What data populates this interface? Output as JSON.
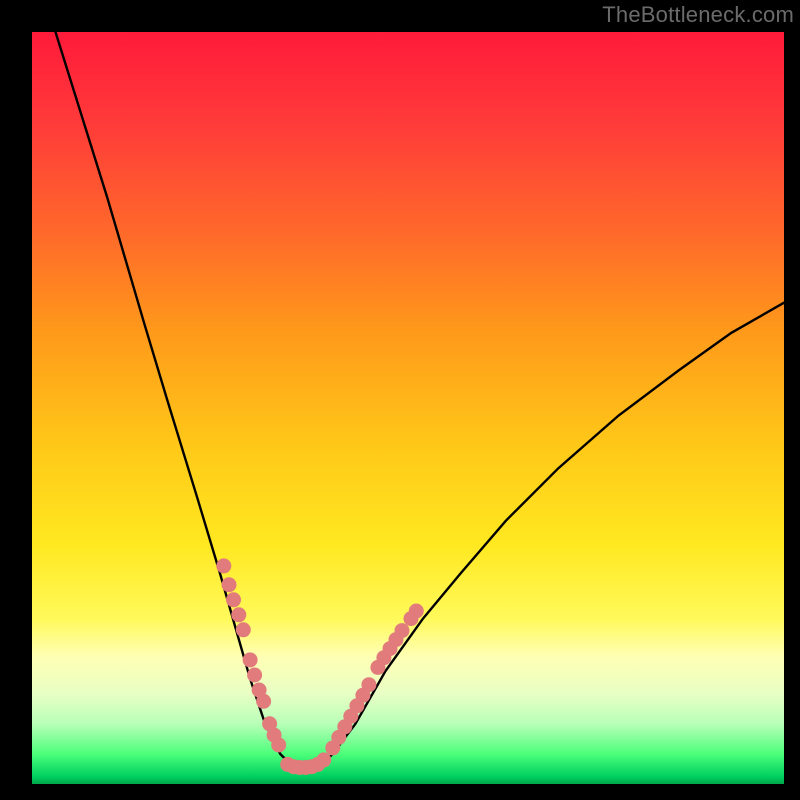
{
  "watermark": "TheBottleneck.com",
  "colors": {
    "frame": "#000000",
    "curve": "#000000",
    "marker": "#e27c7c",
    "gradient_top": "#ff1a3a",
    "gradient_bottom": "#00a84a"
  },
  "chart_data": {
    "type": "line",
    "title": "",
    "xlabel": "",
    "ylabel": "",
    "xlim": [
      0,
      100
    ],
    "ylim": [
      0,
      100
    ],
    "note": "No axis ticks or labels are visible; x/y ranges are normalized 0–100.",
    "series": [
      {
        "name": "bottleneck-curve",
        "x": [
          0,
          5,
          10,
          15,
          18,
          22,
          25,
          27,
          29,
          31,
          33,
          35,
          36,
          38,
          40,
          43,
          47,
          52,
          57,
          63,
          70,
          78,
          86,
          93,
          100
        ],
        "y": [
          110,
          94,
          78,
          61,
          51,
          38,
          28,
          21,
          14,
          8,
          4,
          2,
          2,
          2,
          4,
          8,
          15,
          22,
          28,
          35,
          42,
          49,
          55,
          60,
          64
        ]
      }
    ],
    "markers": [
      {
        "name": "left-cluster-a",
        "x": [
          25.5,
          26.2,
          26.8,
          27.5,
          28.1
        ],
        "y": [
          29,
          26.5,
          24.5,
          22.5,
          20.5
        ]
      },
      {
        "name": "left-cluster-b",
        "x": [
          29.0,
          29.6,
          30.2,
          30.8
        ],
        "y": [
          16.5,
          14.5,
          12.5,
          11
        ]
      },
      {
        "name": "left-cluster-c",
        "x": [
          31.6,
          32.2,
          32.8
        ],
        "y": [
          8.0,
          6.5,
          5.2
        ]
      },
      {
        "name": "bottom-flat",
        "x": [
          34.0,
          34.8,
          35.6,
          36.4,
          37.2,
          38.0,
          38.8
        ],
        "y": [
          2.6,
          2.3,
          2.2,
          2.2,
          2.3,
          2.6,
          3.2
        ]
      },
      {
        "name": "right-cluster-a",
        "x": [
          40.0,
          40.8,
          41.6,
          42.4,
          43.2,
          44.0,
          44.8
        ],
        "y": [
          4.8,
          6.2,
          7.6,
          9.0,
          10.4,
          11.8,
          13.2
        ]
      },
      {
        "name": "right-cluster-b",
        "x": [
          46.0,
          46.8,
          47.6,
          48.4,
          49.2
        ],
        "y": [
          15.5,
          16.8,
          18.0,
          19.2,
          20.4
        ]
      },
      {
        "name": "right-top-dot",
        "x": [
          50.4,
          51.1
        ],
        "y": [
          22.0,
          23.0
        ]
      }
    ]
  }
}
